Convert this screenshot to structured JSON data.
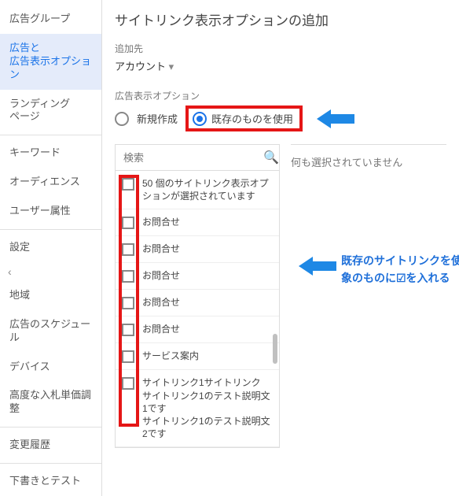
{
  "sidebar": {
    "items": [
      {
        "label": "広告グループ"
      },
      {
        "label": "広告と\n広告表示オプション"
      },
      {
        "label": "ランディング\nページ"
      },
      {
        "label": "キーワード"
      },
      {
        "label": "オーディエンス"
      },
      {
        "label": "ユーザー属性"
      },
      {
        "label": "設定"
      },
      {
        "label": "地域"
      },
      {
        "label": "広告のスケジュール"
      },
      {
        "label": "デバイス"
      },
      {
        "label": "高度な入札単価調整"
      },
      {
        "label": "変更履歴"
      },
      {
        "label": "下書きとテスト"
      }
    ]
  },
  "main": {
    "title": "サイトリンク表示オプションの追加",
    "addTo": {
      "label": "追加先",
      "value": "アカウント"
    },
    "section": {
      "label": "広告表示オプション",
      "radioNew": "新規作成",
      "radioExisting": "既存のものを使用"
    },
    "search": {
      "placeholder": "検索"
    },
    "selectedCountText": "50 個のサイトリンク表示オプションが選択されています",
    "rows": [
      "お問合せ",
      "お問合せ",
      "お問合せ",
      "お問合せ",
      "お問合せ",
      "サービス案内",
      "サイトリンク1サイトリンク\nサイトリンク1のテスト説明文1です\nサイトリンク1のテスト説明文2です"
    ],
    "rightEmpty": "何も選択されていません",
    "annotation": "既存のサイトリンクを使う場合、対象のものに☑を入れる"
  }
}
